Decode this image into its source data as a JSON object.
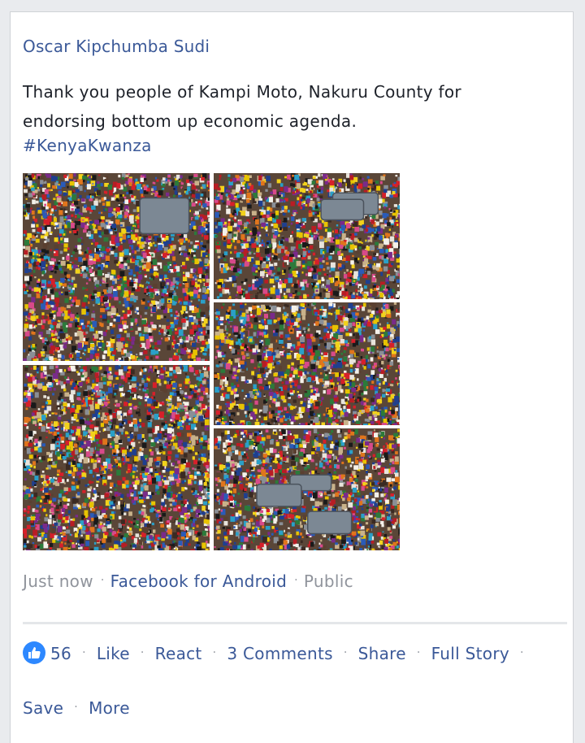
{
  "post": {
    "author": "Oscar Kipchumba Sudi",
    "text": "Thank you people of Kampi Moto, Nakuru County for endorsing bottom up economic agenda.",
    "hashtag": "#KenyaKwanza",
    "photos": [
      {
        "description": "crowd-with-vehicles"
      },
      {
        "description": "crowd-aerial"
      },
      {
        "description": "crowd-aerial"
      },
      {
        "description": "crowd-aerial"
      },
      {
        "description": "crowd-aerial"
      }
    ],
    "meta": {
      "time": "Just now",
      "source": "Facebook for Android",
      "privacy": "Public"
    }
  },
  "actions": {
    "like_count": "56",
    "like": "Like",
    "react": "React",
    "comments": "3 Comments",
    "share": "Share",
    "full_story": "Full Story",
    "save": "Save",
    "more": "More"
  },
  "colors": {
    "link": "#3b5998",
    "muted": "#90949c",
    "like_badge": "#2d88ff"
  }
}
